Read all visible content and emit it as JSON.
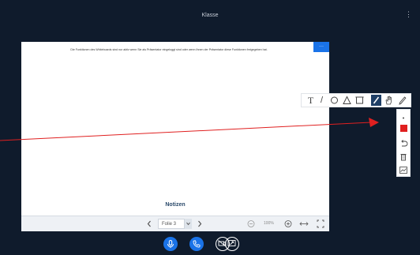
{
  "header": {
    "title": "Klasse",
    "menu_icon": "more-vertical-icon"
  },
  "slide": {
    "instruction_text": "Die Funktionen des Whiteboards sind nur aktiv wenn Sie als Präsentator eingeloggt sind oder wenn Ihnen der Präsentator diese Funktionen freigegeben hat.",
    "corner_button_label": "···",
    "notes_label": "Notizen"
  },
  "bottom_bar": {
    "prev_icon": "chevron-left-icon",
    "slide_select_value": "Folie 3",
    "next_icon": "chevron-right-icon",
    "zoom_out_icon": "zoom-out-icon",
    "zoom_value": "100%",
    "zoom_in_icon": "zoom-in-icon",
    "fit_width_icon": "fit-width-icon",
    "fullscreen_icon": "fullscreen-icon"
  },
  "draw_toolbar": {
    "tools": [
      "text-tool",
      "line-tool",
      "ellipse-tool",
      "triangle-tool",
      "rectangle-tool",
      "pencil-tool",
      "pan-tool",
      "marker-tool"
    ],
    "active_tool": "pencil-tool",
    "text_tool_glyph": "T",
    "line_tool_glyph": "/"
  },
  "side_panel": {
    "items": [
      "stroke-size",
      "color-picker",
      "undo",
      "delete",
      "multi-user"
    ],
    "selected_color": "#e02020"
  },
  "annotation": {
    "color": "#e02020"
  },
  "footer_controls": [
    "microphone-button",
    "phone-button",
    "camera-button",
    "screen-share-button"
  ]
}
